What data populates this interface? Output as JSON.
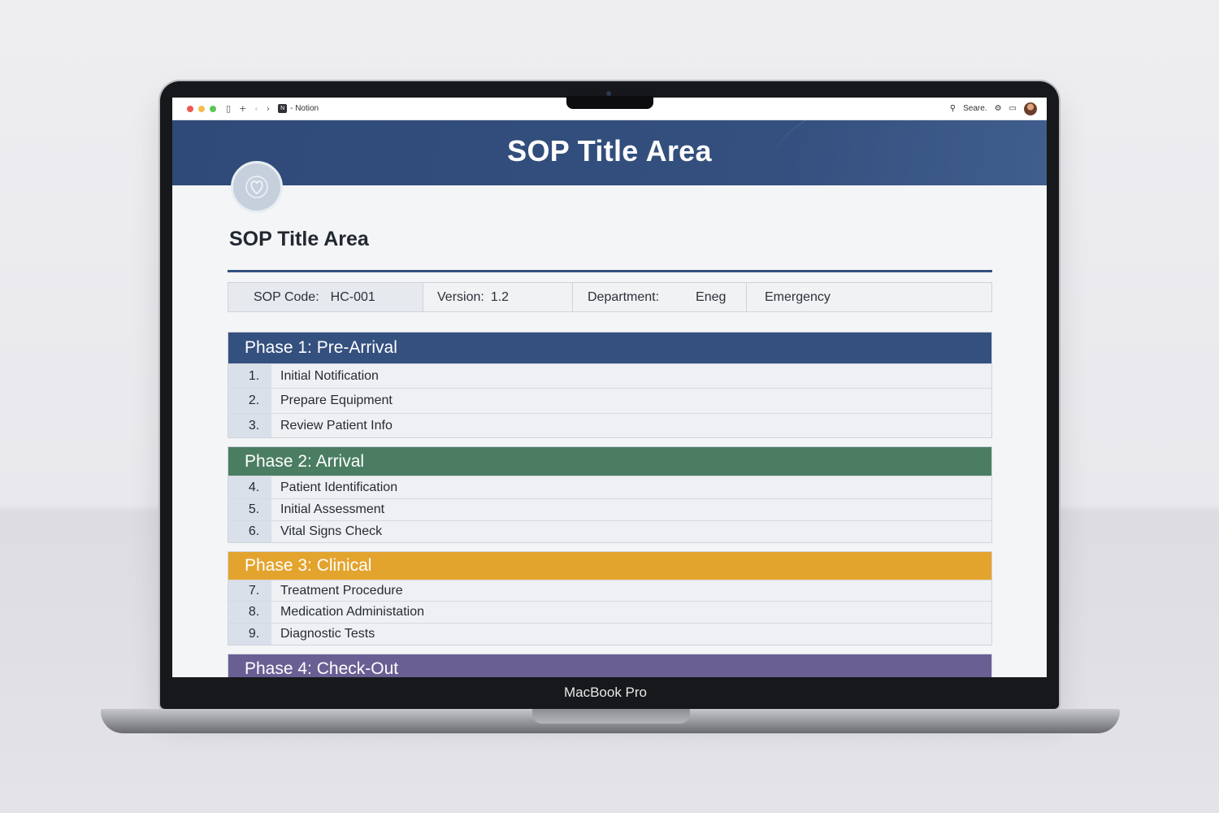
{
  "device": {
    "brand_label": "MacBook Pro"
  },
  "browser": {
    "app_name": "- Notion",
    "search_label": "Seare.",
    "traffic_lights": [
      "#ee5a52",
      "#f4bd4f",
      "#5fc454"
    ]
  },
  "banner": {
    "title": "SOP Title Area",
    "color": "#34507f"
  },
  "page": {
    "title": "SOP Title Area",
    "icon": "heart-icon"
  },
  "meta": {
    "code_label": "SOP Code:",
    "code_value": "HC-001",
    "version_label": "Version:",
    "version_value": "1.2",
    "department_label": "Department:",
    "department_value": "Eneg",
    "extra_value": "Emergency"
  },
  "phases": [
    {
      "title": "Phase 1: Pre-Arrival",
      "color": "#34507f",
      "steps": [
        {
          "num": "1.",
          "label": "Initial Notification"
        },
        {
          "num": "2.",
          "label": "Prepare Equipment"
        },
        {
          "num": "3.",
          "label": "Review Patient Info"
        }
      ]
    },
    {
      "title": "Phase 2: Arrival",
      "color": "#4a7d62",
      "steps": [
        {
          "num": "4.",
          "label": "Patient Identification"
        },
        {
          "num": "5.",
          "label": "Initial Assessment"
        },
        {
          "num": "6.",
          "label": "Vital Signs Check"
        }
      ]
    },
    {
      "title": "Phase 3: Clinical",
      "color": "#e3a42e",
      "steps": [
        {
          "num": "7.",
          "label": "Treatment Procedure"
        },
        {
          "num": "8.",
          "label": "Medication Administation"
        },
        {
          "num": "9.",
          "label": "Diagnostic Tests"
        }
      ]
    },
    {
      "title": "Phase 4: Check-Out",
      "color": "#6a5f93",
      "steps": []
    }
  ]
}
